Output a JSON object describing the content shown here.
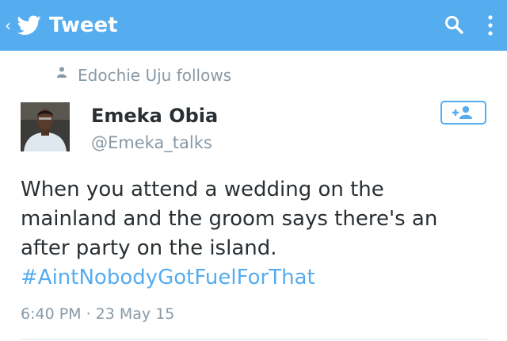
{
  "top_bar": {
    "back_glyph": "‹",
    "logo_icon": "twitter-bird-icon",
    "title": "Tweet",
    "search_icon": "search-icon",
    "menu_icon": "more-vertical-icon",
    "color": "#55acee"
  },
  "context": {
    "icon": "person-icon",
    "text": "Edochie Uju follows"
  },
  "author": {
    "display_name": "Emeka Obia",
    "handle": "@Emeka_talks",
    "follow_icon": "add-user-icon"
  },
  "tweet": {
    "text": "When you attend a wedding on the\nmainland and the groom says there's an\nafter party on the island.",
    "hashtag": "#AintNobodyGotFuelForThat",
    "timestamp": "6:40 PM · 23 May 15"
  },
  "colors": {
    "accent": "#55acee",
    "text": "#292f33",
    "muted": "#8899a6"
  }
}
